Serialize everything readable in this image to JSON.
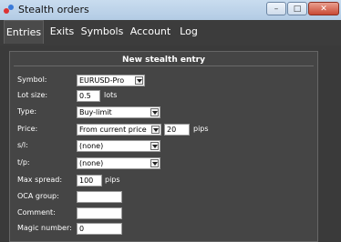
{
  "window": {
    "title": "Stealth orders",
    "buttons": {
      "minimize": "–",
      "maximize": "□",
      "close": "✕"
    }
  },
  "tabs": [
    {
      "label": "Entries",
      "active": true
    },
    {
      "label": "Exits"
    },
    {
      "label": "Symbols"
    },
    {
      "label": "Account"
    },
    {
      "label": "Log"
    }
  ],
  "panel": {
    "title": "New stealth entry"
  },
  "form": {
    "symbol": {
      "label": "Symbol:",
      "value": "EURUSD-Pro"
    },
    "lot_size": {
      "label": "Lot size:",
      "value": "0.5",
      "unit": "lots"
    },
    "type": {
      "label": "Type:",
      "value": "Buy-limit"
    },
    "price": {
      "label": "Price:",
      "value": "From current price",
      "offset": "20",
      "unit": "pips"
    },
    "sl": {
      "label": "s/l:",
      "value": "(none)"
    },
    "tp": {
      "label": "t/p:",
      "value": "(none)"
    },
    "max_spread": {
      "label": "Max spread:",
      "value": "100",
      "unit": "pips"
    },
    "oca_group": {
      "label": "OCA group:",
      "value": ""
    },
    "comment": {
      "label": "Comment:",
      "value": ""
    },
    "magic_number": {
      "label": "Magic number:",
      "value": "0"
    }
  },
  "colors": {
    "background": "#3a3a3a",
    "panel": "#454545",
    "titlebar": "#c9dcef",
    "close": "#c94a34"
  }
}
